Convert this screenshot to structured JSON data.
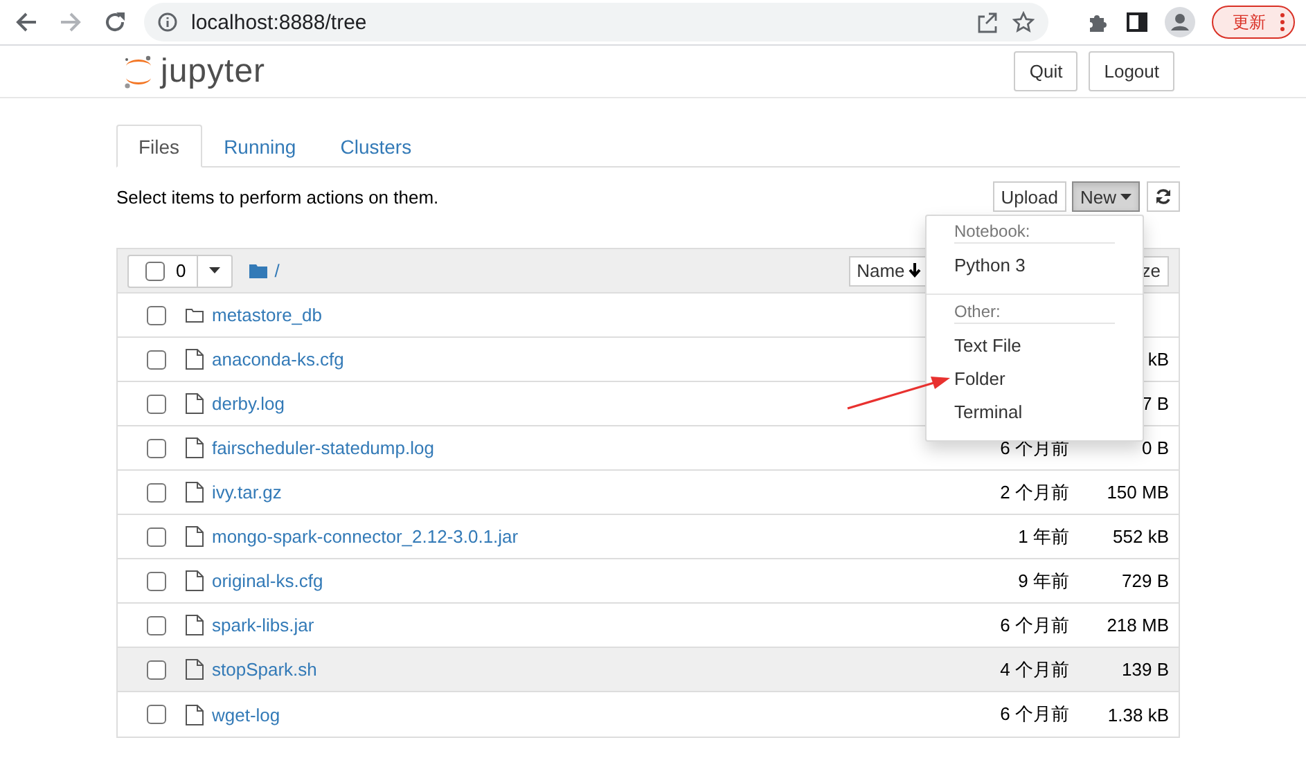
{
  "browser": {
    "url": "localhost:8888/tree",
    "update_label": "更新"
  },
  "header": {
    "logo_text": "jupyter",
    "buttons": [
      "Quit",
      "Logout"
    ]
  },
  "tabs": [
    {
      "label": "Files",
      "selected": true
    },
    {
      "label": "Running",
      "selected": false
    },
    {
      "label": "Clusters",
      "selected": false
    }
  ],
  "toolbar": {
    "hint": "Select items to perform actions on them.",
    "upload": "Upload",
    "new": "New",
    "new_open": true
  },
  "list_header": {
    "all_checked": false,
    "selected_count": "0",
    "path": "/",
    "name_sort": "Name",
    "size_sort": "ze"
  },
  "files": [
    {
      "kind": "folder",
      "name": "metastore_db",
      "checked": false,
      "hovered": false
    },
    {
      "kind": "file",
      "name": "anaconda-ks.cfg",
      "size": "kB",
      "checked": false,
      "hovered": false
    },
    {
      "kind": "file",
      "name": "derby.log",
      "size": "7 B",
      "checked": false,
      "hovered": false
    },
    {
      "kind": "file",
      "name": "fairscheduler-statedump.log",
      "modified": "6 个月前",
      "size": "0 B",
      "checked": false,
      "hovered": false
    },
    {
      "kind": "file",
      "name": "ivy.tar.gz",
      "modified": "2 个月前",
      "size": "150 MB",
      "checked": false,
      "hovered": false
    },
    {
      "kind": "file",
      "name": "mongo-spark-connector_2.12-3.0.1.jar",
      "modified": "1 年前",
      "size": "552 kB",
      "checked": false,
      "hovered": false
    },
    {
      "kind": "file",
      "name": "original-ks.cfg",
      "modified": "9 年前",
      "size": "729 B",
      "checked": false,
      "hovered": false
    },
    {
      "kind": "file",
      "name": "spark-libs.jar",
      "modified": "6 个月前",
      "size": "218 MB",
      "checked": false,
      "hovered": false
    },
    {
      "kind": "file",
      "name": "stopSpark.sh",
      "modified": "4 个月前",
      "size": "139 B",
      "checked": false,
      "hovered": true
    },
    {
      "kind": "file",
      "name": "wget-log",
      "modified": "6 个月前",
      "size": "1.38 kB",
      "checked": false,
      "hovered": false
    }
  ],
  "new_menu": {
    "sections": [
      {
        "heading": "Notebook:",
        "items": [
          "Python 3"
        ]
      },
      {
        "heading": "Other:",
        "items": [
          "Text File",
          "Folder",
          "Terminal"
        ]
      }
    ]
  }
}
